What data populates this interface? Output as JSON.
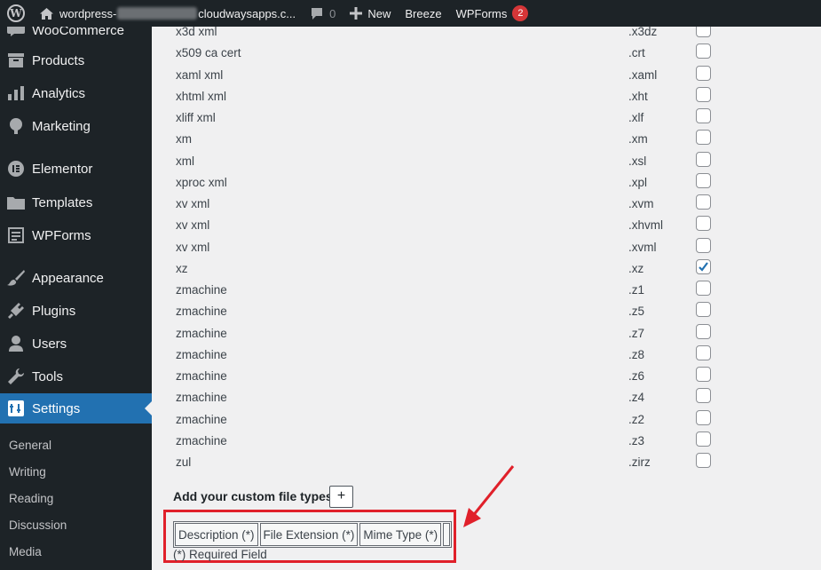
{
  "adminbar": {
    "site_prefix": "wordpress-",
    "site_suffix": "cloudwaysapps.c...",
    "comments_count": "0",
    "new_label": "New",
    "breeze_label": "Breeze",
    "wpforms_label": "WPForms",
    "wpforms_badge": "2"
  },
  "sidebar": {
    "items": [
      {
        "label": "WooCommerce",
        "icon": "woocommerce-icon"
      },
      {
        "label": "Products",
        "icon": "products-icon"
      },
      {
        "label": "Analytics",
        "icon": "analytics-icon"
      },
      {
        "label": "Marketing",
        "icon": "megaphone-icon"
      },
      {
        "label": "Elementor",
        "icon": "elementor-icon"
      },
      {
        "label": "Templates",
        "icon": "folder-icon"
      },
      {
        "label": "WPForms",
        "icon": "form-icon"
      },
      {
        "label": "Appearance",
        "icon": "paintbrush-icon"
      },
      {
        "label": "Plugins",
        "icon": "plug-icon"
      },
      {
        "label": "Users",
        "icon": "user-icon"
      },
      {
        "label": "Tools",
        "icon": "wrench-icon"
      },
      {
        "label": "Settings",
        "icon": "settings-icon"
      }
    ],
    "submenu": [
      "General",
      "Writing",
      "Reading",
      "Discussion",
      "Media"
    ]
  },
  "file_types": [
    {
      "description": "x3d xml",
      "extension": ".x3dz",
      "checked": false
    },
    {
      "description": "x509 ca cert",
      "extension": ".crt",
      "checked": false
    },
    {
      "description": "xaml xml",
      "extension": ".xaml",
      "checked": false
    },
    {
      "description": "xhtml xml",
      "extension": ".xht",
      "checked": false
    },
    {
      "description": "xliff xml",
      "extension": ".xlf",
      "checked": false
    },
    {
      "description": "xm",
      "extension": ".xm",
      "checked": false
    },
    {
      "description": "xml",
      "extension": ".xsl",
      "checked": false
    },
    {
      "description": "xproc xml",
      "extension": ".xpl",
      "checked": false
    },
    {
      "description": "xv xml",
      "extension": ".xvm",
      "checked": false
    },
    {
      "description": "xv xml",
      "extension": ".xhvml",
      "checked": false
    },
    {
      "description": "xv xml",
      "extension": ".xvml",
      "checked": false
    },
    {
      "description": "xz",
      "extension": ".xz",
      "checked": true
    },
    {
      "description": "zmachine",
      "extension": ".z1",
      "checked": false
    },
    {
      "description": "zmachine",
      "extension": ".z5",
      "checked": false
    },
    {
      "description": "zmachine",
      "extension": ".z7",
      "checked": false
    },
    {
      "description": "zmachine",
      "extension": ".z8",
      "checked": false
    },
    {
      "description": "zmachine",
      "extension": ".z6",
      "checked": false
    },
    {
      "description": "zmachine",
      "extension": ".z4",
      "checked": false
    },
    {
      "description": "zmachine",
      "extension": ".z2",
      "checked": false
    },
    {
      "description": "zmachine",
      "extension": ".z3",
      "checked": false
    },
    {
      "description": "zul",
      "extension": ".zirz",
      "checked": false
    }
  ],
  "custom": {
    "label": "Add your custom file types",
    "add_button": "+",
    "columns": [
      "Description (*)",
      "File Extension (*)",
      "Mime Type (*)"
    ],
    "required_note": "(*) Required Field"
  },
  "colors": {
    "accent": "#2271b1",
    "highlight": "#e0202a",
    "adminbar": "#1d2327"
  }
}
